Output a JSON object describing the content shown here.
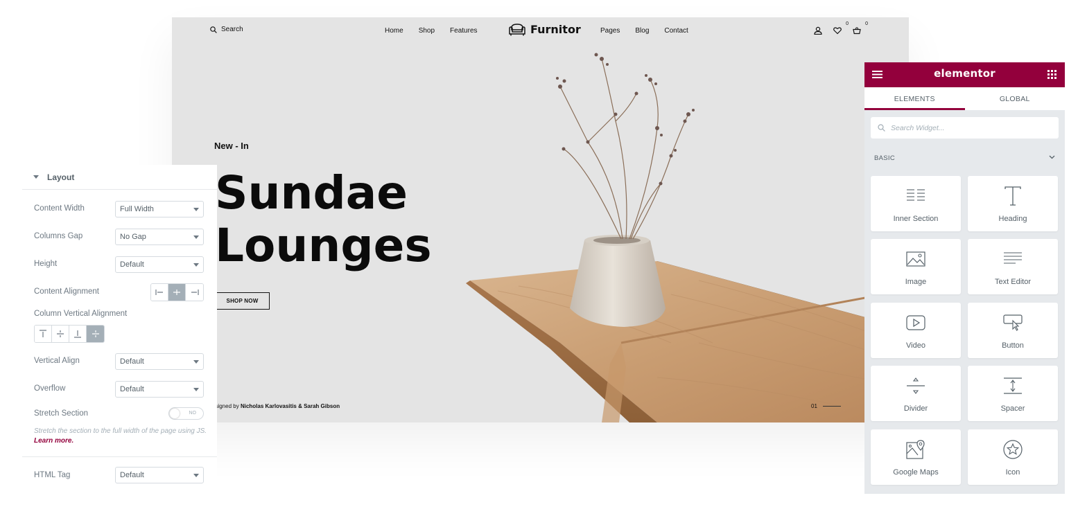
{
  "site": {
    "search_label": "Search",
    "nav_left": [
      "Home",
      "Shop",
      "Features"
    ],
    "logo_text": "Furnitor",
    "nav_right": [
      "Pages",
      "Blog",
      "Contact"
    ],
    "wishlist_count": "0",
    "cart_count": "0",
    "hero": {
      "eyebrow": "New - In",
      "title_line1": "Sundae",
      "title_line2": "Lounges",
      "cta": "SHOP NOW",
      "designer_prefix": "esigned by",
      "designer_names": "Nicholas Karlovasitis & Sarah Gibson",
      "slide_current": "01"
    }
  },
  "settings_panel": {
    "section_title": "Layout",
    "content_width": {
      "label": "Content Width",
      "value": "Full Width"
    },
    "columns_gap": {
      "label": "Columns Gap",
      "value": "No Gap"
    },
    "height": {
      "label": "Height",
      "value": "Default"
    },
    "content_alignment": {
      "label": "Content Alignment",
      "active_index": 1
    },
    "column_vertical_alignment": {
      "label": "Column Vertical Alignment",
      "active_index": 3
    },
    "vertical_align": {
      "label": "Vertical Align",
      "value": "Default"
    },
    "overflow": {
      "label": "Overflow",
      "value": "Default"
    },
    "stretch_section": {
      "label": "Stretch Section",
      "toggle_text": "NO",
      "description": "Stretch the section to the full width of the page using JS.",
      "learn_more": "Learn more."
    },
    "html_tag": {
      "label": "HTML Tag",
      "value": "Default"
    }
  },
  "elementor": {
    "brand": "elementor",
    "tabs": [
      "ELEMENTS",
      "GLOBAL"
    ],
    "active_tab": 0,
    "search_placeholder": "Search Widget...",
    "category": "BASIC",
    "widgets": [
      {
        "label": "Inner Section",
        "icon": "inner-section-icon"
      },
      {
        "label": "Heading",
        "icon": "heading-icon"
      },
      {
        "label": "Image",
        "icon": "image-icon"
      },
      {
        "label": "Text Editor",
        "icon": "text-editor-icon"
      },
      {
        "label": "Video",
        "icon": "video-icon"
      },
      {
        "label": "Button",
        "icon": "button-icon"
      },
      {
        "label": "Divider",
        "icon": "divider-icon"
      },
      {
        "label": "Spacer",
        "icon": "spacer-icon"
      },
      {
        "label": "Google Maps",
        "icon": "google-maps-icon"
      },
      {
        "label": "Icon",
        "icon": "star-icon"
      }
    ]
  },
  "colors": {
    "brand": "#93003c",
    "site_bg": "#e4e4e4",
    "panel_bg": "#e6e9ec",
    "label": "#6d7882"
  }
}
